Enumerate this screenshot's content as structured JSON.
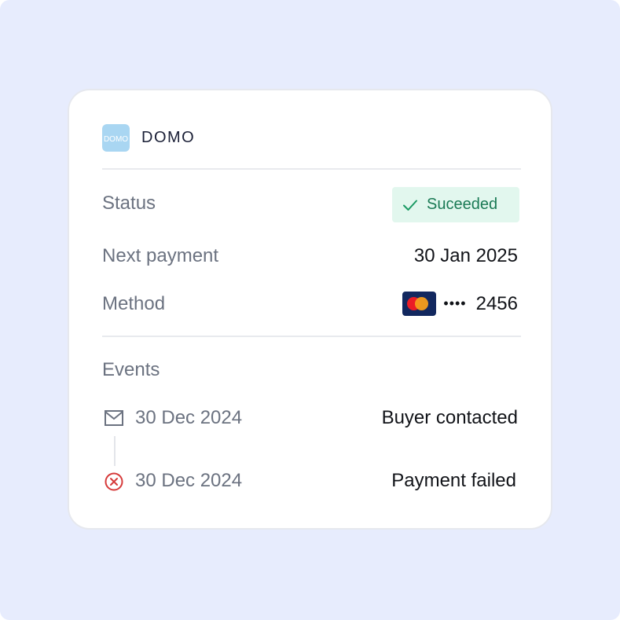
{
  "merchant": {
    "name": "DOMO",
    "logo_text": "DOMO",
    "logo_color": "#a9d6f2"
  },
  "details": {
    "status_label": "Status",
    "status_value": "Suceeded",
    "status_icon": "check-icon",
    "status_color": "#1a7a55",
    "next_payment_label": "Next payment",
    "next_payment_value": "30 Jan 2025",
    "method_label": "Method",
    "method_card_brand_icon": "mastercard-icon",
    "method_masked": "••••",
    "method_last4": "2456"
  },
  "events": {
    "heading": "Events",
    "items": [
      {
        "icon": "mail-icon",
        "date": "30 Dec 2024",
        "title": "Buyer contacted"
      },
      {
        "icon": "error-circle-icon",
        "date": "30 Dec 2024",
        "title": "Payment failed",
        "color": "#d63a3a"
      }
    ]
  }
}
